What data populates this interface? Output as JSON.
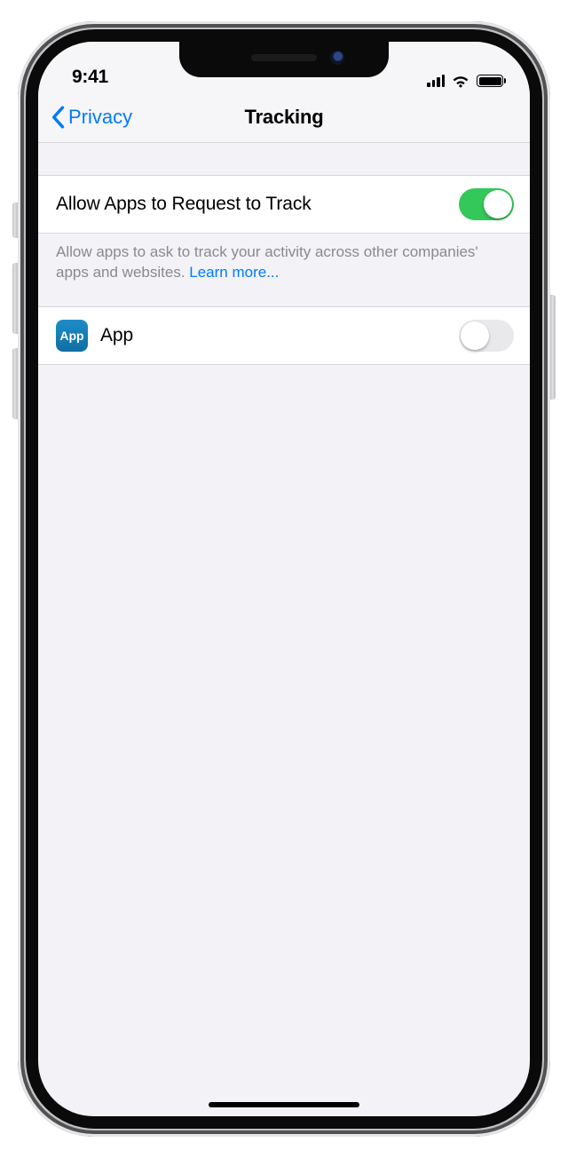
{
  "status": {
    "time": "9:41"
  },
  "nav": {
    "back_label": "Privacy",
    "title": "Tracking"
  },
  "main_toggle": {
    "label": "Allow Apps to Request to Track",
    "value": true,
    "footer_text": "Allow apps to ask to track your activity across other companies' apps and websites. ",
    "learn_more": "Learn more..."
  },
  "apps": [
    {
      "name": "App",
      "icon_text": "App",
      "tracking_allowed": false
    }
  ],
  "colors": {
    "tint": "#007aff",
    "switch_on": "#34c759",
    "group_bg": "#f2f2f7"
  }
}
